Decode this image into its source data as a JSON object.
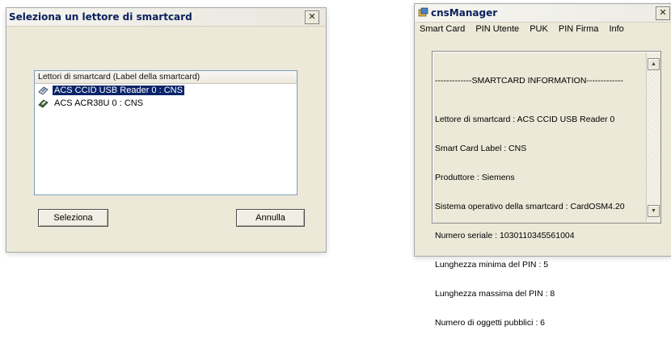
{
  "select_dialog": {
    "title": "Seleziona un lettore di smartcard",
    "close_label": "✕",
    "list": {
      "header": "Lettori di smartcard (Label della smartcard)",
      "items": [
        {
          "label": "ACS CCID USB Reader 0 : CNS",
          "selected": true,
          "icon": "smartcard-reader-icon"
        },
        {
          "label": "ACS ACR38U 0 : CNS",
          "selected": false,
          "icon": "smartcard-reader-icon"
        }
      ]
    },
    "buttons": {
      "select_label": "Seleziona",
      "cancel_label": "Annulla"
    }
  },
  "manager_window": {
    "title": "cnsManager",
    "icon": "cns-app-icon",
    "close_label": "✕",
    "menu": [
      "Smart Card",
      "PIN Utente",
      "PUK",
      "PIN Firma",
      "Info"
    ],
    "info": {
      "header": "-------------SMARTCARD INFORMATION-------------",
      "lines": [
        "Lettore di smartcard : ACS CCID USB Reader 0",
        "Smart Card Label : CNS",
        "Produttore : Siemens",
        "Sistema operativo della smartcard : CardOSM4.20",
        "Numero seriale : 1030110345561004",
        "Lunghezza minima del PIN : 5",
        "Lunghezza massima del PIN : 8",
        "Numero di oggetti pubblici : 6"
      ]
    }
  },
  "colors": {
    "dialog_bg": "#ece9d8",
    "selection": "#0a246a",
    "title_text": "#0a1f5c"
  }
}
